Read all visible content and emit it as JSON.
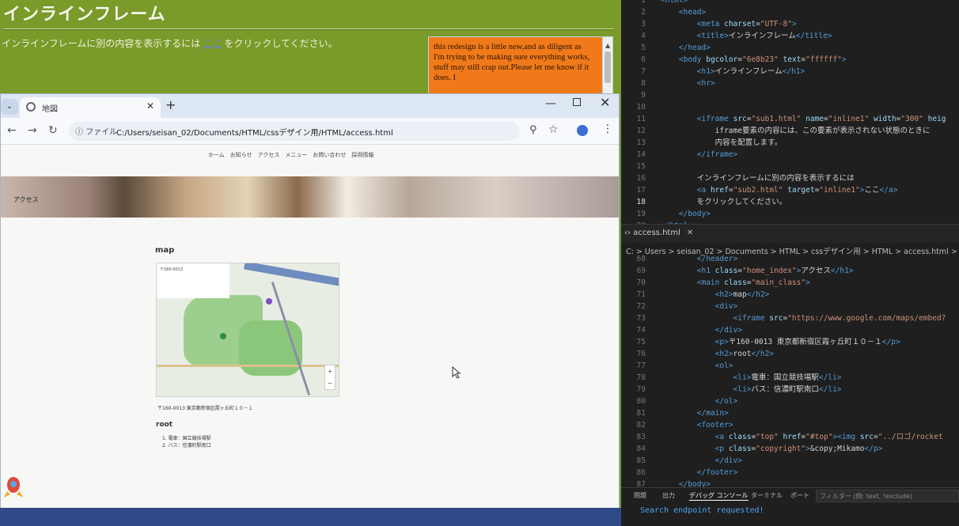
{
  "green_page": {
    "title": "インラインフレーム",
    "text_before": "インラインフレームに別の内容を表示するには",
    "link": "ここ",
    "text_after": "をクリックしてください。",
    "iframe_text": "this redesign is a little new,and as diligent as I'm trying to be making sure everything works, stuff may still crap out.Please let me know if it does. I"
  },
  "browser": {
    "tab_title": "地図",
    "url_scheme": "ファイル",
    "url": "C:/Users/seisan_02/Documents/HTML/cssデザイン用/HTML/access.html",
    "hero_label": "アクセス",
    "nav": [
      "ホーム",
      "お知らせ",
      "アクセス",
      "メニュー",
      "お問い合わせ",
      "採用情報"
    ],
    "map_heading": "map",
    "map_panel_text": "〒160-0013",
    "address": "〒160-0013 東京都新宿区霞ヶ丘町１０－１",
    "root_heading": "root",
    "root_items": [
      "1. 電車：国立競技場駅",
      "2. バス：信濃町駅南口"
    ]
  },
  "editor_top": {
    "lines": [
      {
        "n": "1",
        "html": "<span class='t'>&lt;html&gt;</span>"
      },
      {
        "n": "2",
        "html": "    <span class='t'>&lt;head&gt;</span>"
      },
      {
        "n": "3",
        "html": "        <span class='t'>&lt;meta</span> <span class='a'>charset</span>=<span class='s'>\"UTF-8\"</span><span class='t'>&gt;</span>"
      },
      {
        "n": "4",
        "html": "        <span class='t'>&lt;title&gt;</span><span class='tx'>インラインフレーム</span><span class='t'>&lt;/title&gt;</span>"
      },
      {
        "n": "5",
        "html": "    <span class='t'>&lt;/head&gt;</span>"
      },
      {
        "n": "6",
        "html": "    <span class='t'>&lt;body</span> <span class='a'>bgcolor</span>=<span class='s'>\"6e8b23\"</span> <span class='a'>text</span>=<span class='s'>\"ffffff\"</span><span class='t'>&gt;</span>"
      },
      {
        "n": "7",
        "html": "        <span class='t'>&lt;h1&gt;</span><span class='tx'>インラインフレーム</span><span class='t'>&lt;/h1&gt;</span>"
      },
      {
        "n": "8",
        "html": "        <span class='t'>&lt;hr&gt;</span>"
      },
      {
        "n": "9",
        "html": ""
      },
      {
        "n": "10",
        "html": ""
      },
      {
        "n": "11",
        "html": "        <span class='t'>&lt;iframe</span> <span class='a'>src</span>=<span class='s'>\"sub1.html\"</span> <span class='a'>name</span>=<span class='s'>\"inline1\"</span> <span class='a'>width</span>=<span class='s'>\"300\"</span> <span class='a'>heig</span>"
      },
      {
        "n": "12",
        "html": "            <span class='tx'>iframe要素の内容には、この要素が表示されない状態のときに</span>"
      },
      {
        "n": "13",
        "html": "            <span class='tx'>内容を配置します。</span>"
      },
      {
        "n": "14",
        "html": "        <span class='t'>&lt;/iframe&gt;</span>"
      },
      {
        "n": "15",
        "html": ""
      },
      {
        "n": "16",
        "html": "        <span class='tx'>インラインフレームに別の内容を表示するには</span>"
      },
      {
        "n": "17",
        "html": "        <span class='t'>&lt;a</span> <span class='a'>href</span>=<span class='s'>\"sub2.html\"</span> <span class='a'>target</span>=<span class='s'>\"inline1\"</span><span class='t'>&gt;</span><span class='tx'>ここ</span><span class='t'>&lt;/a&gt;</span>"
      },
      {
        "n": "18",
        "html": "        <span class='tx'>をクリックしてください。</span>",
        "cur": true
      },
      {
        "n": "19",
        "html": "    <span class='t'>&lt;/body&gt;</span>"
      },
      {
        "n": "20",
        "html": "<span class='t'>&lt;/html&gt;</span>"
      }
    ]
  },
  "editor_bottom": {
    "file_tab": "access.html",
    "breadcrumb": "C: > Users > seisan_02 > Documents > HTML > cssデザイン用 > HTML > access.html >",
    "lines": [
      {
        "n": "68",
        "html": "        <span class='t'>&lt;/header&gt;</span>"
      },
      {
        "n": "69",
        "html": "        <span class='t'>&lt;h1</span> <span class='a'>class</span>=<span class='s'>\"home_index\"</span><span class='t'>&gt;</span><span class='tx'>アクセス</span><span class='t'>&lt;/h1&gt;</span>"
      },
      {
        "n": "70",
        "html": "        <span class='t'>&lt;main</span> <span class='a'>class</span>=<span class='s'>\"main_class\"</span><span class='t'>&gt;</span>"
      },
      {
        "n": "71",
        "html": "            <span class='t'>&lt;h2&gt;</span><span class='tx'>map</span><span class='t'>&lt;/h2&gt;</span>"
      },
      {
        "n": "72",
        "html": "            <span class='t'>&lt;div&gt;</span>"
      },
      {
        "n": "73",
        "html": "                <span class='t'>&lt;iframe</span> <span class='a'>src</span>=<span class='s'>\"https://www.google.com/maps/embed?</span>"
      },
      {
        "n": "74",
        "html": "            <span class='t'>&lt;/div&gt;</span>"
      },
      {
        "n": "75",
        "html": "            <span class='t'>&lt;p&gt;</span><span class='tx'>〒160-0013 東京都新宿区霞ヶ丘町１０－１</span><span class='t'>&lt;/p&gt;</span>"
      },
      {
        "n": "76",
        "html": "            <span class='t'>&lt;h2&gt;</span><span class='tx'>root</span><span class='t'>&lt;/h2&gt;</span>"
      },
      {
        "n": "77",
        "html": "            <span class='t'>&lt;ol&gt;</span>"
      },
      {
        "n": "78",
        "html": "                <span class='t'>&lt;li&gt;</span><span class='tx'>電車：国立競技場駅</span><span class='t'>&lt;/li&gt;</span>"
      },
      {
        "n": "79",
        "html": "                <span class='t'>&lt;li&gt;</span><span class='tx'>バス：信濃町駅南口</span><span class='t'>&lt;/li&gt;</span>"
      },
      {
        "n": "80",
        "html": "            <span class='t'>&lt;/ol&gt;</span>"
      },
      {
        "n": "81",
        "html": "        <span class='t'>&lt;/main&gt;</span>"
      },
      {
        "n": "82",
        "html": "        <span class='t'>&lt;footer&gt;</span>"
      },
      {
        "n": "83",
        "html": "            <span class='t'>&lt;a</span> <span class='a'>class</span>=<span class='s'>\"top\"</span> <span class='a'>href</span>=<span class='s'>\"#top\"</span><span class='t'>&gt;&lt;img</span> <span class='a'>src</span>=<span class='s'>\"../ロゴ/rocket</span>"
      },
      {
        "n": "84",
        "html": "            <span class='t'>&lt;p</span> <span class='a'>class</span>=<span class='s'>\"copyright\"</span><span class='t'>&gt;</span><span class='tx'>&amp;copy;Mikamo</span><span class='t'>&lt;/p&gt;</span>"
      },
      {
        "n": "85",
        "html": "            <span class='t'>&lt;/div&gt;</span>"
      },
      {
        "n": "86",
        "html": "        <span class='t'>&lt;/footer&gt;</span>"
      },
      {
        "n": "87",
        "html": "    <span class='t'>&lt;/body&gt;</span>"
      }
    ]
  },
  "panel": {
    "tabs": [
      "問題",
      "出力",
      "デバッグ コンソール",
      "ターミナル",
      "ポート"
    ],
    "filter_placeholder": "フィルター (例: text, !exclude)",
    "message": "Search endpoint requested!"
  }
}
